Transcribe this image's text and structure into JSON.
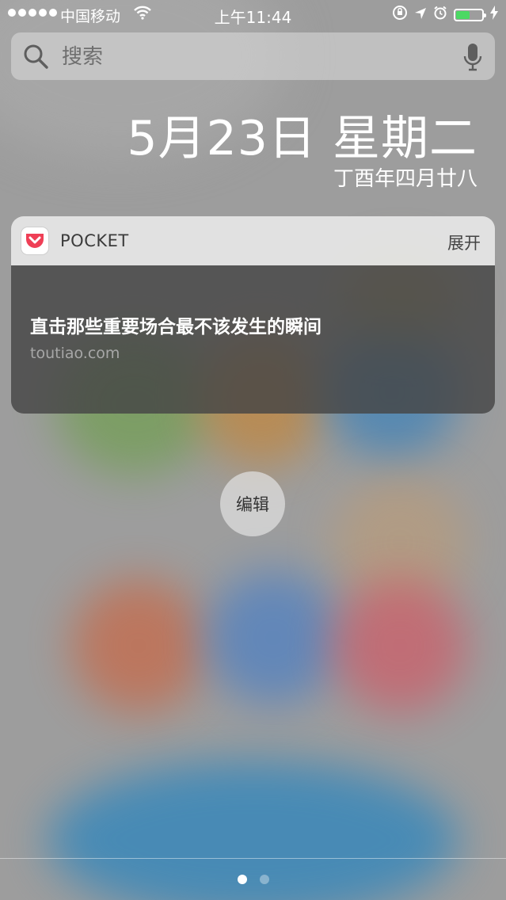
{
  "status_bar": {
    "carrier": "中国移动",
    "time": "上午11:44",
    "signal_bars": 5,
    "battery_level": 0.5,
    "icons": [
      "wifi-icon",
      "orientation-lock-icon",
      "location-icon",
      "alarm-icon",
      "battery-icon",
      "charging-icon"
    ]
  },
  "search": {
    "placeholder": "搜索",
    "icon": "search-icon",
    "mic_icon": "microphone-icon"
  },
  "date": {
    "main": "5月23日 星期二",
    "lunar": "丁酉年四月廿八"
  },
  "widget": {
    "app_name": "POCKET",
    "expand_label": "展开",
    "article_title": "直击那些重要场合最不该发生的瞬间",
    "article_source": "toutiao.com",
    "brand_color": "#ef3f56"
  },
  "edit_label": "编辑",
  "page_indicator": {
    "current": 1,
    "total": 2
  }
}
